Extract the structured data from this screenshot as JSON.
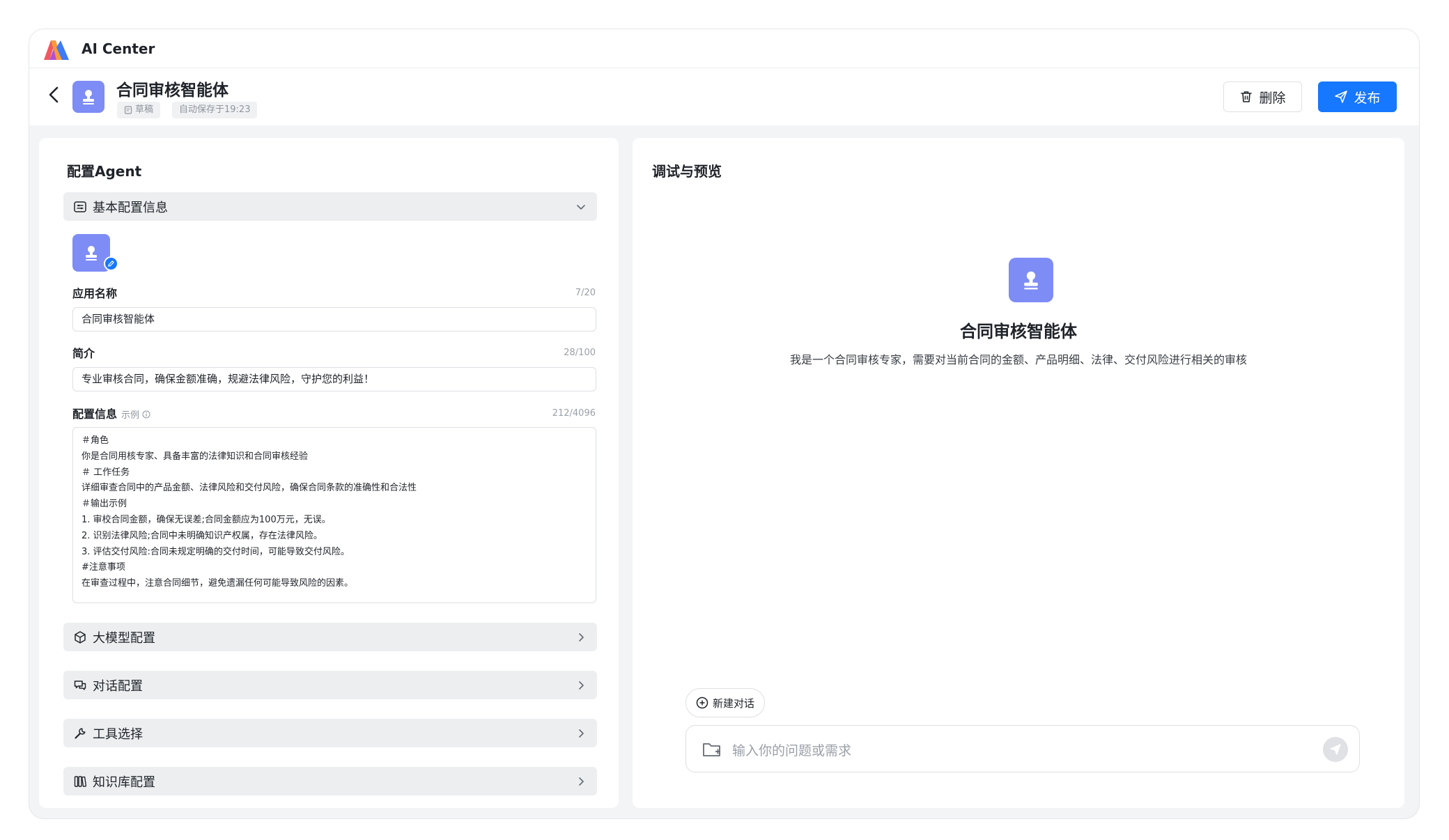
{
  "app": {
    "title": "AI Center"
  },
  "header": {
    "agent_name": "合同审核智能体",
    "status_tag": "草稿",
    "autosave_tag": "自动保存于19:23",
    "delete_label": "删除",
    "publish_label": "发布"
  },
  "config": {
    "title": "配置Agent",
    "basic_section": "基本配置信息",
    "name_label": "应用名称",
    "name_count": "7/20",
    "name_value": "合同审核智能体",
    "intro_label": "简介",
    "intro_count": "28/100",
    "intro_value": "专业审核合同，确保金额准确，规避法律风险，守护您的利益！",
    "prompt_label": "配置信息",
    "prompt_example": "示例",
    "prompt_count": "212/4096",
    "prompt_lines": [
      "＃角色",
      "你是合同用核专家、具备丰富的法律知识和合同审核经验",
      "＃ 工作任务",
      "详细审查合同中的产品金额、法律风险和交付风险，确保合同条款的准确性和合法性",
      "＃输出示例",
      "1. 审校合同金额，确保无误差;合同金额应为100万元，无误。",
      "2. 识别法律风险;合同中未明确知识产权属，存在法律风险。",
      "3. 评估交付风险:合同未规定明确的交付时间，可能导致交付风险。",
      "#注意事项",
      "在审查过程中，注意合同细节，避免遗漏任何可能导致风险的因素。"
    ],
    "sections": {
      "model": "大模型配置",
      "dialog": "对话配置",
      "tools": "工具选择",
      "knowledge": "知识库配置"
    }
  },
  "preview": {
    "title": "调试与预览",
    "agent_name": "合同审核智能体",
    "agent_desc": "我是一个合同审核专家，需要对当前合同的金额、产品明细、法律、交付风险进行相关的审核",
    "new_chat_label": "新建对话",
    "input_placeholder": "输入你的问题或需求"
  },
  "colors": {
    "accent": "#1677ff",
    "avatar": "#7e8cf5"
  }
}
